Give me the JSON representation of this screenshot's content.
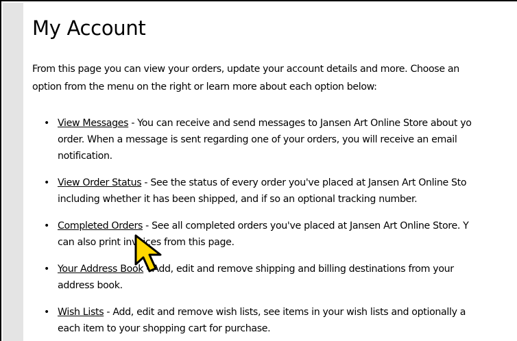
{
  "page": {
    "title": "My Account",
    "intro_line1": "From this page you can view your orders, update your account details and more. Choose an",
    "intro_line2": "option from the menu on the right or learn more about each option below:"
  },
  "options": [
    {
      "link": "View Messages",
      "line1": " - You can receive and send messages to Jansen Art Online Store about yo",
      "line2": "order. When a message is sent regarding one of your orders, you will receive an email",
      "line3": "notification."
    },
    {
      "link": "View Order Status",
      "line1": " - See the status of every order you've placed at Jansen Art Online Sto",
      "line2": "including whether it has been shipped, and if so an optional tracking number."
    },
    {
      "link": "Completed Orders",
      "line1": " - See all completed orders you've placed at Jansen Art Online Store. Y",
      "line2": "can also print invoices from this page."
    },
    {
      "link": "Your Address Book",
      "line1": " - Add, edit and remove shipping and billing destinations from your",
      "line2": "address book."
    },
    {
      "link": "Wish Lists",
      "line1": " - Add, edit and remove wish lists, see items in your wish lists and optionally a",
      "line2": "each item to your shopping cart for purchase."
    }
  ],
  "colors": {
    "gutter": "#e4e4e4",
    "cursor_fill": "#ffd800",
    "text": "#000000"
  },
  "icons": {
    "bullet": "•",
    "cursor": "arrow-pointer-icon"
  }
}
